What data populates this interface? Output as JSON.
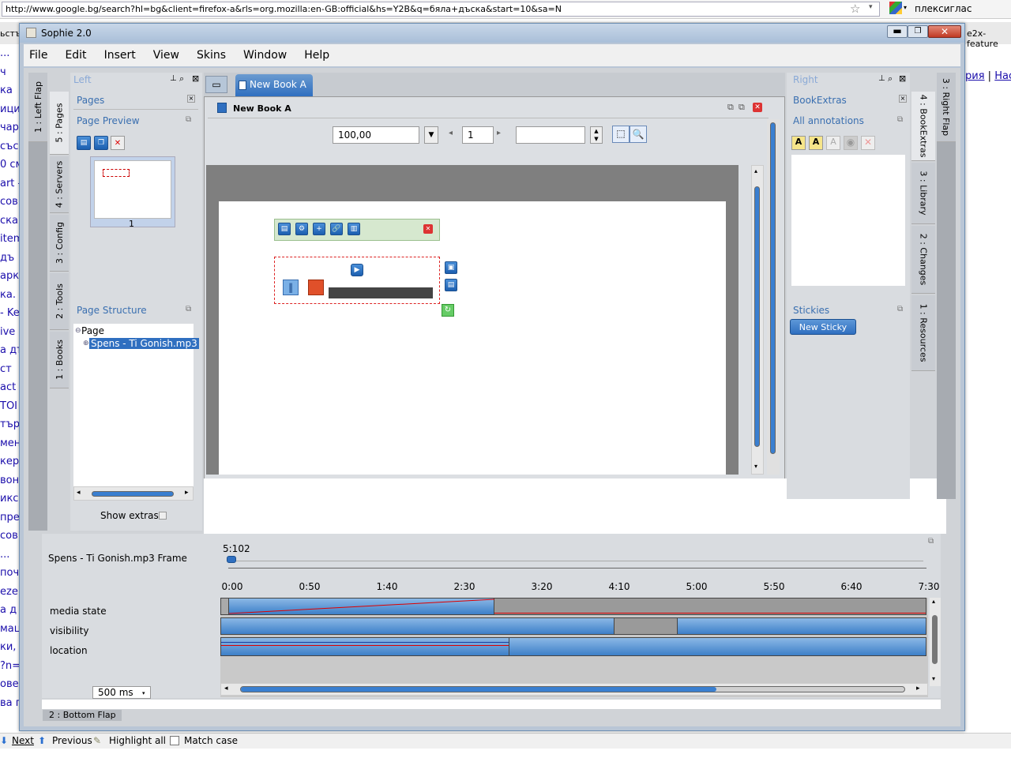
{
  "browser": {
    "url": "http://www.google.bg/search?hl=bg&client=firefox-a&rls=org.mozilla:en-GB:official&hs=Y2B&q=бяла+дъска&start=10&sa=N",
    "search_text": "плексиглас",
    "tab_fragments": [
      "ьстъ",
      "e2x-feature"
    ],
    "left_edge": [
      "...",
      "ч",
      "ка",
      "ици",
      "чар",
      "със",
      "0 см",
      "art -",
      "сов",
      "ска",
      "item",
      "дъ",
      "арк",
      "ка.",
      "- Ke",
      "ive",
      "а дъ",
      "ст",
      "act",
      "TOI",
      "тър",
      "мен",
      "кер",
      "вон",
      "икс",
      "пре",
      "сов",
      "...",
      "поч",
      "eze",
      "а д",
      "мац",
      "ки,",
      "?n=",
      "ове",
      "ва п"
    ],
    "right_edge": [
      "рия",
      "|",
      "Наст"
    ],
    "find_bar": {
      "next": "Next",
      "previous": "Previous",
      "highlight": "Highlight all",
      "match_case": "Match case"
    }
  },
  "app": {
    "title": "Sophie 2.0",
    "menu": [
      "File",
      "Edit",
      "Insert",
      "View",
      "Skins",
      "Window",
      "Help"
    ]
  },
  "left_flap": {
    "title": "Left",
    "flap_label": "1 : Left Flap",
    "tabs": [
      "5 : Pages",
      "4 : Servers",
      "3 : Config",
      "2 : Tools",
      "1 : Books"
    ],
    "pages_title": "Pages",
    "preview_title": "Page Preview",
    "page_number": "1",
    "structure_title": "Page Structure",
    "tree_root": "Page",
    "tree_child": "Spens - Ti Gonish.mp3",
    "show_extras": "Show extras"
  },
  "book": {
    "tab_label": "New Book A",
    "window_title": "New Book A",
    "zoom": "100,00",
    "page": "1",
    "page_field": ""
  },
  "right_flap": {
    "title": "Right",
    "flap_label": "3 : Right Flap",
    "tabs": [
      "4 : BookExtras",
      "3 : Library",
      "2 : Changes",
      "1 : Resources"
    ],
    "bookextras_title": "BookExtras",
    "annotations_title": "All annotations",
    "stickies_title": "Stickies",
    "new_sticky": "New Sticky"
  },
  "timeline": {
    "frame_title": "Spens - Ti Gonish.mp3 Frame",
    "current_time": "5:102",
    "ticks": [
      "0:00",
      "0:50",
      "1:40",
      "2:30",
      "3:20",
      "4:10",
      "5:00",
      "5:50",
      "6:40",
      "7:30"
    ],
    "tracks": [
      "media state",
      "visibility",
      "location"
    ],
    "step": "500 ms",
    "bottom_flap": "2 : Bottom Flap"
  },
  "colors": {
    "accent_blue": "#3a7fd0",
    "panel_bg": "#d4d7db",
    "selection": "#2f6fc0"
  }
}
